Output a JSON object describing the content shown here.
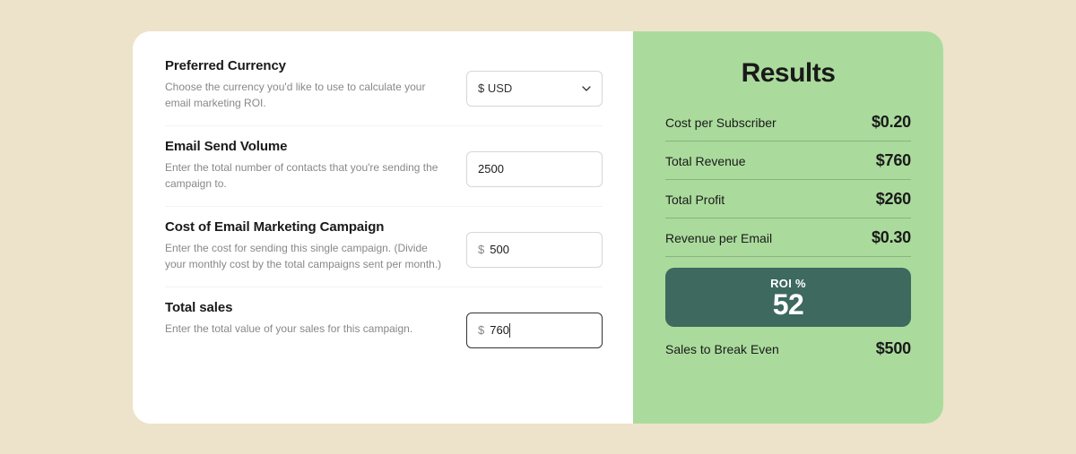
{
  "inputs": {
    "currency": {
      "title": "Preferred Currency",
      "desc": "Choose the currency you'd like to use to calculate your email marketing ROI.",
      "value": "$ USD"
    },
    "volume": {
      "title": "Email Send Volume",
      "desc": "Enter the total number of contacts that you're sending the campaign to.",
      "value": "2500"
    },
    "cost": {
      "title": "Cost of Email Marketing Campaign",
      "desc": "Enter the cost for sending this single campaign. (Divide your monthly cost by the total campaigns sent per month.)",
      "prefix": "$",
      "value": "500"
    },
    "sales": {
      "title": "Total sales",
      "desc": "Enter the total value of your sales for this campaign.",
      "prefix": "$",
      "value": "760"
    }
  },
  "results": {
    "title": "Results",
    "rows": [
      {
        "label": "Cost per Subscriber",
        "value": "$0.20"
      },
      {
        "label": "Total Revenue",
        "value": "$760"
      },
      {
        "label": "Total Profit",
        "value": "$260"
      },
      {
        "label": "Revenue per Email",
        "value": "$0.30"
      }
    ],
    "roi": {
      "label": "ROI %",
      "value": "52"
    },
    "breakEven": {
      "label": "Sales to Break Even",
      "value": "$500"
    }
  }
}
